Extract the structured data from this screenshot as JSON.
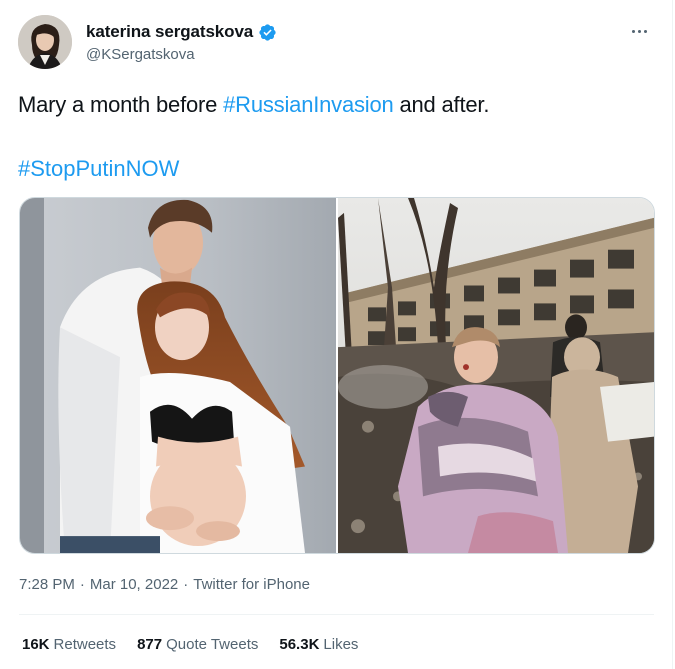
{
  "author": {
    "display_name": "katerina sergatskova",
    "handle": "@KSergatskova",
    "verified": true
  },
  "tweet": {
    "line1_before": "Mary a month before ",
    "line1_hashtag": "#RussianInvasion",
    "line1_after": " and after.",
    "line2_hashtag": "#StopPutinNOW"
  },
  "media": {
    "image_left_alt": "pregnant-couple-photo",
    "image_right_alt": "bombed-hospital-photo"
  },
  "meta": {
    "time": "7:28 PM",
    "sep1": "·",
    "date": "Mar 10, 2022",
    "sep2": "·",
    "source": "Twitter for iPhone"
  },
  "stats": {
    "retweets_count": "16K",
    "retweets_label": "Retweets",
    "quotes_count": "877",
    "quotes_label": "Quote Tweets",
    "likes_count": "56.3K",
    "likes_label": "Likes"
  },
  "colors": {
    "accent": "#1d9bf0",
    "text": "#0f1419",
    "secondary": "#536471"
  },
  "icons": {
    "verified": "verified-badge-icon",
    "more": "more-options-icon"
  }
}
